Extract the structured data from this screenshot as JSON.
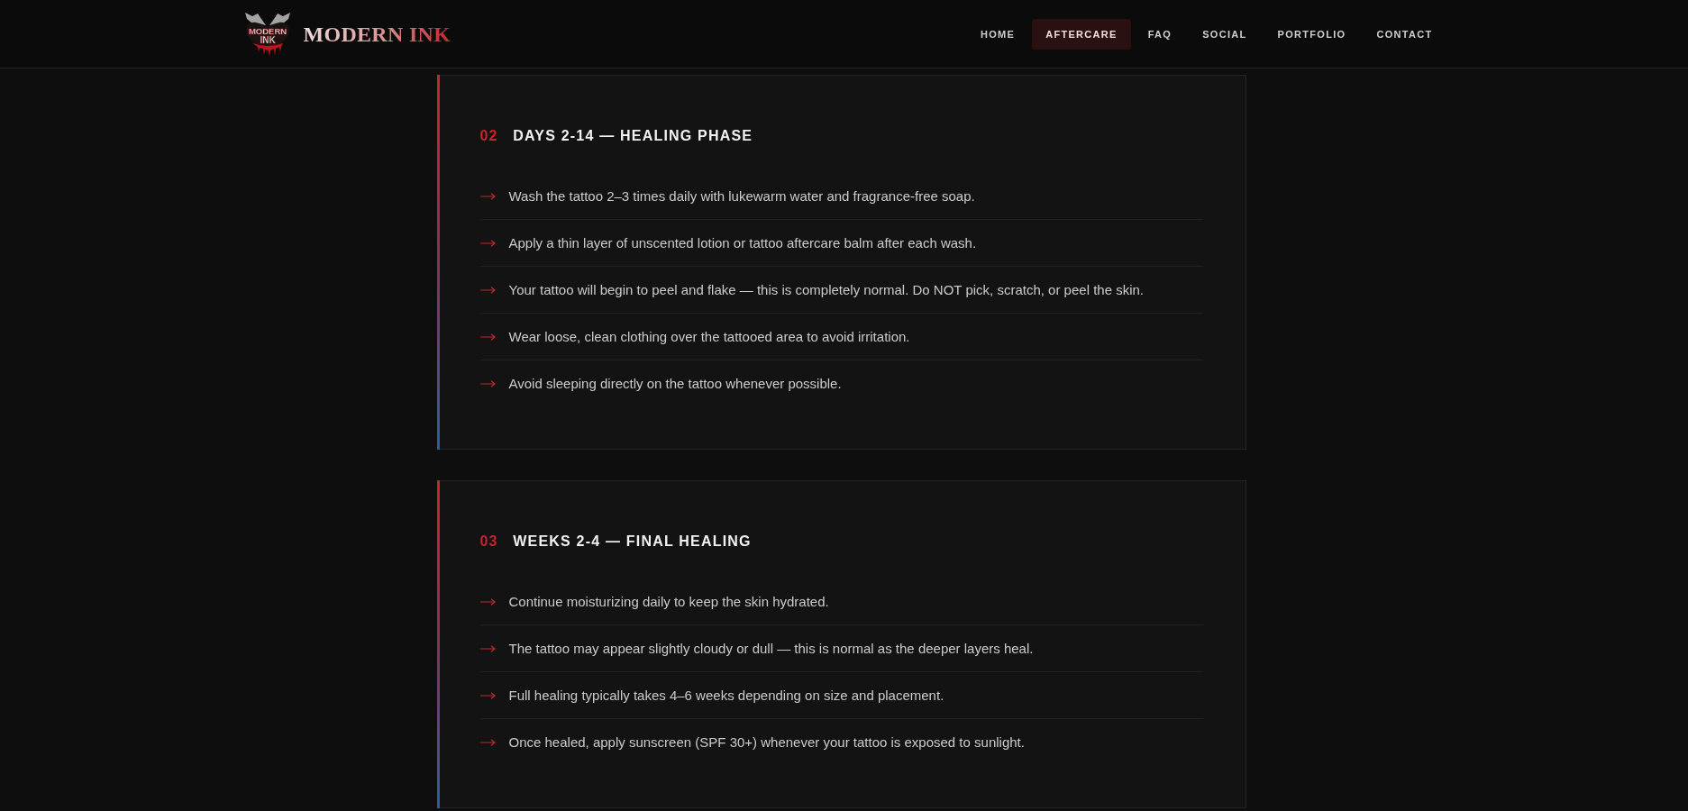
{
  "header": {
    "logo": {
      "badge_lines": [
        "MODERN",
        "INK"
      ],
      "name": "MODERN INK"
    },
    "nav": [
      {
        "label": "HOME",
        "selected": false
      },
      {
        "label": "AFTERCARE",
        "selected": true
      },
      {
        "label": "FAQ",
        "selected": false
      },
      {
        "label": "SOCIAL",
        "selected": false
      },
      {
        "label": "PORTFOLIO",
        "selected": false
      },
      {
        "label": "CONTACT",
        "selected": false
      }
    ]
  },
  "sections": [
    {
      "number": "02",
      "title": "DAYS 2-14 — HEALING PHASE",
      "items": [
        "Wash the tattoo 2–3 times daily with lukewarm water and fragrance-free soap.",
        "Apply a thin layer of unscented lotion or tattoo aftercare balm after each wash.",
        "Your tattoo will begin to peel and flake — this is completely normal. Do NOT pick, scratch, or peel the skin.",
        "Wear loose, clean clothing over the tattooed area to avoid irritation.",
        "Avoid sleeping directly on the tattoo whenever possible."
      ]
    },
    {
      "number": "03",
      "title": "WEEKS 2-4 — FINAL HEALING",
      "items": [
        "Continue moisturizing daily to keep the skin hydrated.",
        "The tattoo may appear slightly cloudy or dull — this is normal as the deeper layers heal.",
        "Full healing typically takes 4–6 weeks depending on size and placement.",
        "Once healed, apply sunscreen (SPF 30+) whenever your tattoo is exposed to sunlight."
      ]
    }
  ]
}
